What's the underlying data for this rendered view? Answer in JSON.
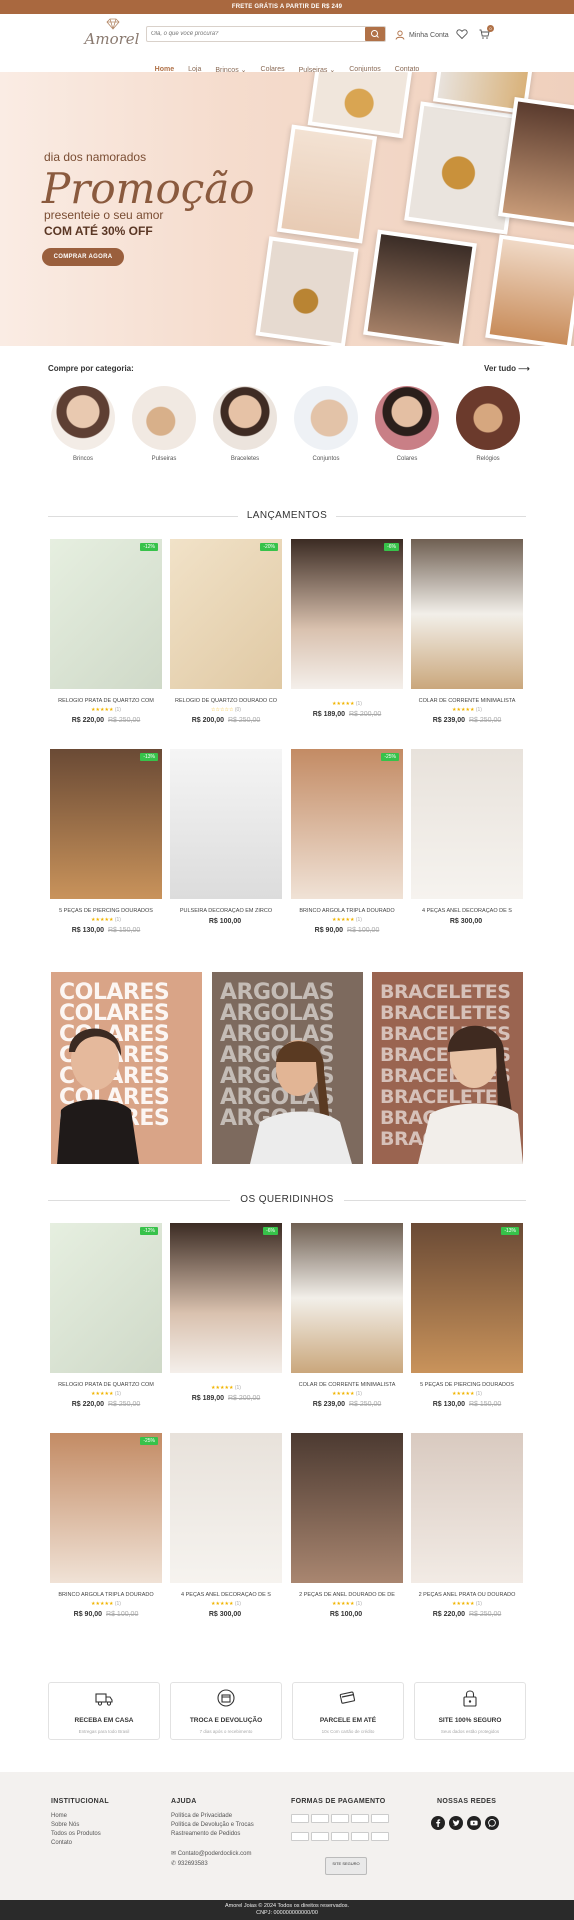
{
  "topbar": {
    "text": "FRETE GRÁTIS A PARTIR DE R$ 249"
  },
  "header": {
    "logo_text": "Amorel",
    "search_placeholder": "Olá, o que você procura?",
    "account_label": "Minha Conta",
    "cart_count": "0"
  },
  "nav": [
    "Home",
    "Loja",
    "Brincos ⌄",
    "Colares",
    "Pulseiras ⌄",
    "Conjuntos",
    "Contato"
  ],
  "hero": {
    "tagline": "dia dos namorados",
    "headline": "Promoção",
    "subline": "presenteie o seu amor",
    "discount": "COM ATÉ 30% OFF",
    "cta": "COMPRAR AGORA"
  },
  "categories": {
    "heading": "Compre por categoria:",
    "see_all": "Ver tudo ⟶",
    "items": [
      "Brincos",
      "Pulseiras",
      "Braceletes",
      "Conjuntos",
      "Colares",
      "Relógios"
    ]
  },
  "launches": {
    "title": "LANÇAMENTOS",
    "products": [
      {
        "name": "RELÓGIO PRATA DE QUARTZO COM",
        "stars": "★★★★★",
        "count": "(1)",
        "price": "R$ 220,00",
        "old": "R$ 250,00",
        "badge": "-12%"
      },
      {
        "name": "RELÓGIO DE QUARTZO DOURADO CO",
        "stars": "☆☆☆☆☆",
        "count": "(0)",
        "price": "R$ 200,00",
        "old": "R$ 250,00",
        "badge": "-20%"
      },
      {
        "name": "",
        "stars": "★★★★★",
        "count": "(1)",
        "price": "R$ 189,00",
        "old": "R$ 200,00",
        "badge": "-6%"
      },
      {
        "name": "COLAR DE CORRENTE MINIMALISTA",
        "stars": "★★★★★",
        "count": "(1)",
        "price": "R$ 239,00",
        "old": "R$ 250,00",
        "badge": ""
      },
      {
        "name": "5 PEÇAS DE PIERCING DOURADOS",
        "stars": "★★★★★",
        "count": "(1)",
        "price": "R$ 130,00",
        "old": "R$ 150,00",
        "badge": "-13%"
      },
      {
        "name": "PULSEIRA DECORAÇÃO EM ZIRCO",
        "stars": "",
        "count": "",
        "price": "R$ 100,00",
        "old": "",
        "badge": ""
      },
      {
        "name": "BRINCO ARGOLA TRIPLA DOURADO",
        "stars": "★★★★★",
        "count": "(1)",
        "price": "R$ 90,00",
        "old": "R$ 100,00",
        "badge": "-25%"
      },
      {
        "name": "4 PEÇAS ANEL DECORAÇÃO DE S",
        "stars": "",
        "count": "",
        "price": "R$ 300,00",
        "old": "",
        "badge": ""
      }
    ]
  },
  "banners": [
    {
      "word": "COLARES"
    },
    {
      "word": "ARGOLAS"
    },
    {
      "word": "BRACELETES"
    }
  ],
  "favorites": {
    "title": "OS QUERIDINHOS",
    "products": [
      {
        "name": "RELÓGIO PRATA DE QUARTZO COM",
        "stars": "★★★★★",
        "count": "(1)",
        "price": "R$ 220,00",
        "old": "R$ 250,00",
        "badge": "-12%"
      },
      {
        "name": "",
        "stars": "★★★★★",
        "count": "(1)",
        "price": "R$ 189,00",
        "old": "R$ 200,00",
        "badge": "-6%"
      },
      {
        "name": "COLAR DE CORRENTE MINIMALISTA",
        "stars": "★★★★★",
        "count": "(1)",
        "price": "R$ 239,00",
        "old": "R$ 250,00",
        "badge": ""
      },
      {
        "name": "5 PEÇAS DE PIERCING DOURADOS",
        "stars": "★★★★★",
        "count": "(1)",
        "price": "R$ 130,00",
        "old": "R$ 150,00",
        "badge": "-13%"
      },
      {
        "name": "BRINCO ARGOLA TRIPLA DOURADO",
        "stars": "★★★★★",
        "count": "(1)",
        "price": "R$ 90,00",
        "old": "R$ 100,00",
        "badge": "-25%"
      },
      {
        "name": "4 PEÇAS ANEL DECORAÇÃO DE S",
        "stars": "★★★★★",
        "count": "(1)",
        "price": "R$ 300,00",
        "old": "",
        "badge": ""
      },
      {
        "name": "2 PEÇAS DE ANEL DOURADO DE DE",
        "stars": "★★★★★",
        "count": "(1)",
        "price": "R$ 100,00",
        "old": "",
        "badge": ""
      },
      {
        "name": "2 PEÇAS ANEL PRATA OU DOURADO",
        "stars": "★★★★★",
        "count": "(1)",
        "price": "R$ 220,00",
        "old": "R$ 250,00",
        "badge": ""
      }
    ]
  },
  "features": [
    {
      "title": "RECEBA EM CASA",
      "sub": "Entregas para todo Brasil"
    },
    {
      "title": "TROCA E DEVOLUÇÃO",
      "sub": "7 dias após o recebimento"
    },
    {
      "title": "PARCELE EM ATÉ",
      "sub": "10x Com cartão de crédito"
    },
    {
      "title": "SITE 100% SEGURO",
      "sub": "Seus dados estão protegidos"
    }
  ],
  "footer": {
    "institutional": {
      "heading": "INSTITUCIONAL",
      "links": [
        "Home",
        "Sobre Nós",
        "Todos os Produtos",
        "Contato"
      ]
    },
    "help": {
      "heading": "AJUDA",
      "links": [
        "Política de Privacidade",
        "Política de Devolução e Trocas",
        "Rastreamento de Pedidos"
      ],
      "email": "Contato@poderdoclick.com",
      "phone": "932693583"
    },
    "payment": {
      "heading": "FORMAS DE PAGAMENTO",
      "secure": "SITE SEGURO"
    },
    "social": {
      "heading": "NOSSAS REDES"
    }
  },
  "copyright": {
    "line1": "Amorel Joias © 2024 Todos os direitos reservados.",
    "line2": "CNPJ: 000000000000/00"
  },
  "colors": {
    "brand": "#a9683f",
    "badge": "#37c24a"
  }
}
